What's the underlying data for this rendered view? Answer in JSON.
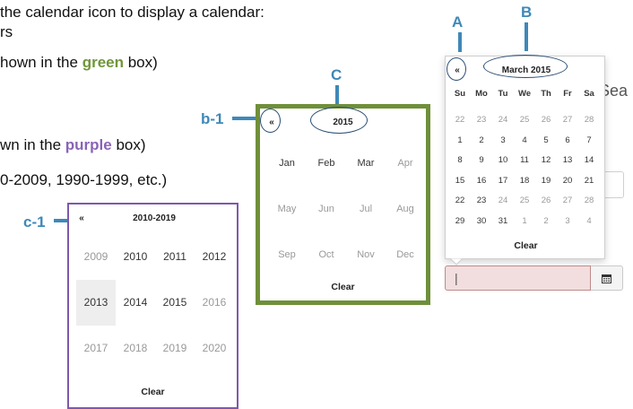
{
  "doc": {
    "line1": "the calendar icon to display a calendar:",
    "line2": "rs",
    "line3_prefix": "hown in the ",
    "line3_word": "green",
    "line3_suffix": " box)",
    "line4_prefix": "wn in the ",
    "line4_word": "purple",
    "line4_suffix": " box)",
    "line5": "0-2009, 1990-1999, etc.)",
    "side_text": "Sea"
  },
  "callouts": {
    "a": "A",
    "b": "B",
    "c": "C",
    "b1": "b-1",
    "c1": "c-1"
  },
  "colors": {
    "callout": "#3f88b8",
    "green_box": "#6f8f3a",
    "purple_box": "#7e58ad",
    "ellipse": "#2b4e75",
    "invalid_field": "#f2dede"
  },
  "day_picker": {
    "prev": "«",
    "title": "March 2015",
    "weekdays": [
      "Su",
      "Mo",
      "Tu",
      "We",
      "Th",
      "Fr",
      "Sa"
    ],
    "weeks": [
      [
        "22",
        "23",
        "24",
        "25",
        "26",
        "27",
        "28"
      ],
      [
        "1",
        "2",
        "3",
        "4",
        "5",
        "6",
        "7"
      ],
      [
        "8",
        "9",
        "10",
        "11",
        "12",
        "13",
        "14"
      ],
      [
        "15",
        "16",
        "17",
        "18",
        "19",
        "20",
        "21"
      ],
      [
        "22",
        "23",
        "24",
        "25",
        "26",
        "27",
        "28"
      ],
      [
        "29",
        "30",
        "31",
        "1",
        "2",
        "3",
        "4"
      ]
    ],
    "clear": "Clear",
    "input_value": "|",
    "calendar_icon": "calendar-icon"
  },
  "month_picker": {
    "prev": "«",
    "title": "2015",
    "months": [
      "Jan",
      "Feb",
      "Mar",
      "Apr",
      "May",
      "Jun",
      "Jul",
      "Aug",
      "Sep",
      "Oct",
      "Nov",
      "Dec"
    ],
    "clear": "Clear"
  },
  "year_picker": {
    "prev": "«",
    "title": "2010-2019",
    "years": [
      "2009",
      "2010",
      "2011",
      "2012",
      "2013",
      "2014",
      "2015",
      "2016",
      "2017",
      "2018",
      "2019",
      "2020"
    ],
    "clear": "Clear"
  }
}
